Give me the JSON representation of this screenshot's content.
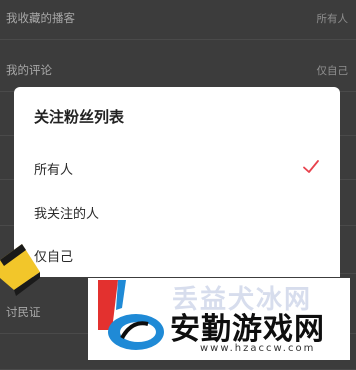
{
  "settings": {
    "rows": [
      {
        "label": "我收藏的播客",
        "value": "所有人"
      },
      {
        "label": "我的评论",
        "value": "仅自己"
      },
      {
        "label": "",
        "value": ""
      },
      {
        "label": "",
        "value": ""
      },
      {
        "label": "",
        "value": ""
      },
      {
        "label": "",
        "value": ""
      },
      {
        "label": "讨民证",
        "value": ""
      },
      {
        "label": "",
        "value": ""
      }
    ]
  },
  "dialog": {
    "title": "关注粉丝列表",
    "options": [
      {
        "label": "所有人",
        "selected": true
      },
      {
        "label": "我关注的人",
        "selected": false
      },
      {
        "label": "仅自己",
        "selected": false
      }
    ],
    "check_color": "#e8424d"
  },
  "watermark": {
    "title": "安勤游戏网",
    "ghost_title": "丢益犬冰网",
    "url": "www.hzaccw.com",
    "colors": {
      "red": "#e3312f",
      "blue": "#1f8ad6",
      "dark": "#0e0e0e"
    }
  }
}
